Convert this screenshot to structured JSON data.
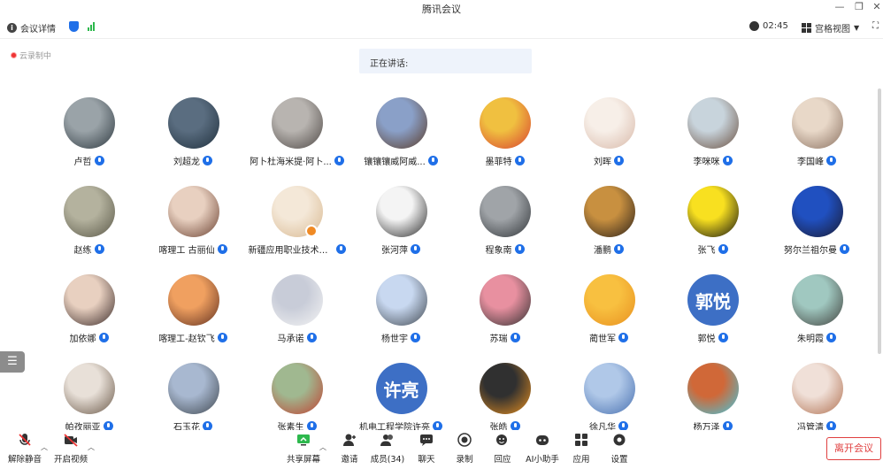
{
  "window": {
    "title": "腾讯会议"
  },
  "infobar": {
    "meeting_details": "会议详情",
    "time": "02:45",
    "view_mode": "宫格视图"
  },
  "recording_status": "云录制中",
  "speaking_label": "正在讲话:",
  "participants": [
    {
      "name": "卢哲",
      "colors": [
        "#9aa3a8",
        "#2e3940"
      ]
    },
    {
      "name": "刘超龙",
      "colors": [
        "#5a6d80",
        "#20303d"
      ]
    },
    {
      "name": "阿卜杜海米提·阿卜...",
      "colors": [
        "#b8b4b0",
        "#4e4845"
      ]
    },
    {
      "name": "镶镶镶威阿威...",
      "colors": [
        "#8aa0c8",
        "#5a3b28"
      ]
    },
    {
      "name": "墨菲特",
      "colors": [
        "#f0c040",
        "#d84030"
      ]
    },
    {
      "name": "刘晖",
      "colors": [
        "#f7efe8",
        "#d8b8a8"
      ]
    },
    {
      "name": "李咪咪",
      "colors": [
        "#c8d4dc",
        "#6a5040"
      ]
    },
    {
      "name": "李国峰",
      "colors": [
        "#e8d8c8",
        "#8a7060"
      ]
    },
    {
      "name": "赵练",
      "colors": [
        "#b4b29e",
        "#5a5848"
      ]
    },
    {
      "name": "喀理工  古丽仙",
      "colors": [
        "#e8d0c0",
        "#6a4030"
      ]
    },
    {
      "name": "新疆应用职业技术学...",
      "colors": [
        "#f4e8d8",
        "#d8b890"
      ],
      "badge": true
    },
    {
      "name": "张河萍",
      "colors": [
        "#f4f4f4",
        "#2a2a2a"
      ]
    },
    {
      "name": "程象南",
      "colors": [
        "#a0a4a8",
        "#303438"
      ]
    },
    {
      "name": "潘鹏",
      "colors": [
        "#c89040",
        "#2a2018"
      ]
    },
    {
      "name": "张飞",
      "colors": [
        "#f8e020",
        "#101010"
      ]
    },
    {
      "name": "努尔兰祖尔曼",
      "colors": [
        "#2050c0",
        "#1a1a30"
      ]
    },
    {
      "name": "加依娜",
      "colors": [
        "#e8d0c0",
        "#3a2a28"
      ]
    },
    {
      "name": "喀理工-赵钦飞",
      "colors": [
        "#f0a060",
        "#603020"
      ]
    },
    {
      "name": "马承诺",
      "colors": [
        "#c8ccd8",
        "#f4f4f4"
      ]
    },
    {
      "name": "杨世宇",
      "colors": [
        "#c8d8f0",
        "#404850"
      ]
    },
    {
      "name": "苏瑞",
      "colors": [
        "#e890a0",
        "#303030"
      ]
    },
    {
      "name": "蔺世军",
      "colors": [
        "#f8c040",
        "#e89020"
      ]
    },
    {
      "name": "郭悦",
      "colors": [
        "#3d6fc5",
        "#3d6fc5"
      ],
      "text": "郭悦"
    },
    {
      "name": "朱明霞",
      "colors": [
        "#a0c8c0",
        "#40403c"
      ]
    },
    {
      "name": "帕孜丽亚",
      "colors": [
        "#e8e0d8",
        "#6a5848"
      ]
    },
    {
      "name": "石玉花",
      "colors": [
        "#a8b8d0",
        "#404850"
      ]
    },
    {
      "name": "张素生",
      "colors": [
        "#a0b890",
        "#c04030"
      ]
    },
    {
      "name": "机电工程学院许亮",
      "colors": [
        "#3d6fc5",
        "#3d6fc5"
      ],
      "text": "许亮"
    },
    {
      "name": "张皓",
      "colors": [
        "#303030",
        "#e89020"
      ]
    },
    {
      "name": "徐凡华",
      "colors": [
        "#b0c8e8",
        "#4870b0"
      ]
    },
    {
      "name": "杨万泽",
      "colors": [
        "#d06838",
        "#40c8e0"
      ]
    },
    {
      "name": "冯管清",
      "colors": [
        "#f0e0d8",
        "#b07050"
      ]
    }
  ],
  "toolbar": {
    "unmute": "解除静音",
    "start_video": "开启视频",
    "share_screen": "共享屏幕",
    "invite": "邀请",
    "members": "成员(34)",
    "chat": "聊天",
    "record": "录制",
    "reactions": "回应",
    "ai_assistant": "AI小助手",
    "apps": "应用",
    "settings": "设置"
  },
  "leave_button": "离开会议",
  "colors": {
    "accent": "#1f6fe8",
    "leave": "#e04040",
    "speaking_bg": "#eef3fb"
  }
}
